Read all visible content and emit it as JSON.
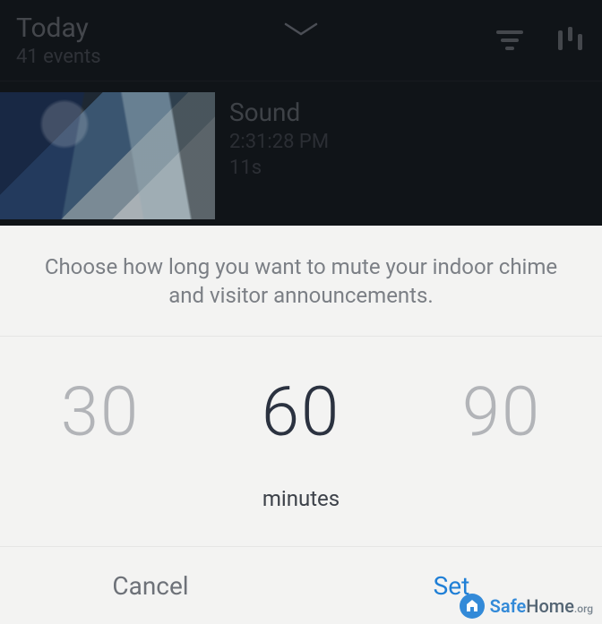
{
  "header": {
    "title": "Today",
    "subtitle": "41 events"
  },
  "event": {
    "title": "Sound",
    "time": "2:31:28 PM",
    "duration": "11s"
  },
  "sheet": {
    "prompt": "Choose how long you want to mute your indoor chime and visitor announcements.",
    "options": {
      "prev": "30",
      "selected": "60",
      "next": "90"
    },
    "unit_label": "minutes",
    "cancel_label": "Cancel",
    "set_label": "Set"
  },
  "watermark": {
    "brand": "Safe",
    "suffix": "Home",
    "tld": ".org"
  }
}
